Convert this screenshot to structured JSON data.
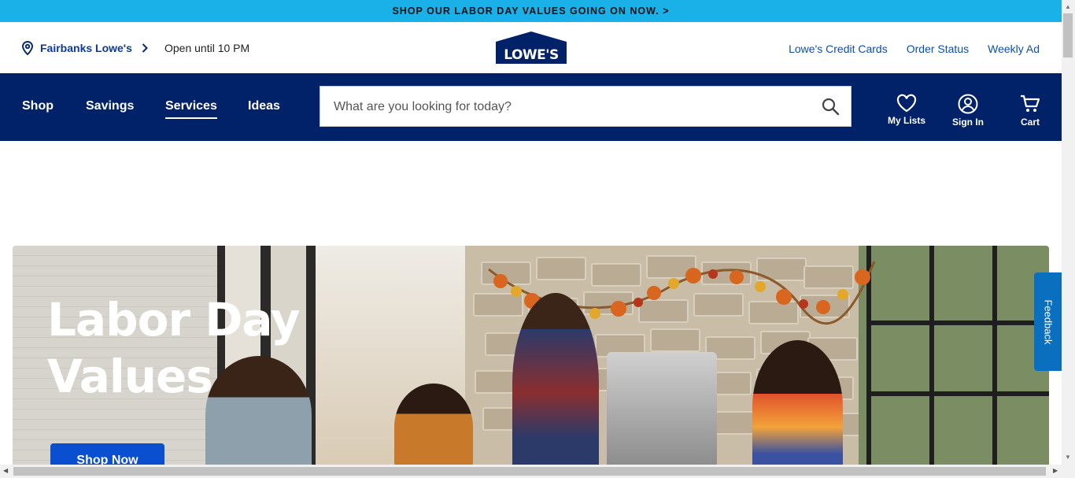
{
  "promo_banner": {
    "text": "SHOP OUR LABOR DAY VALUES GOING ON NOW. >"
  },
  "utility_bar": {
    "store_name": "Fairbanks Lowe's",
    "store_hours": "Open until 10 PM",
    "logo_text": "LOWE'S",
    "links": [
      "Lowe's Credit Cards",
      "Order Status",
      "Weekly Ad"
    ]
  },
  "main_nav": {
    "items": [
      "Shop",
      "Savings",
      "Services",
      "Ideas"
    ],
    "active_item": "Services",
    "search": {
      "placeholder": "What are you looking for today?",
      "value": ""
    },
    "icons": [
      {
        "label": "My Lists",
        "icon": "heart-icon"
      },
      {
        "label": "Sign In",
        "icon": "user-circle-icon"
      },
      {
        "label": "Cart",
        "icon": "cart-icon"
      }
    ]
  },
  "hero": {
    "title_line1": "Labor Day",
    "title_line2": "Values",
    "cta_label": "Shop Now"
  },
  "feedback_tab": {
    "label": "Feedback"
  },
  "colors": {
    "promo": "#1ab0e8",
    "nav": "#012169",
    "link": "#0b4fb0",
    "cta": "#0b4fd1",
    "feedback": "#0b6fc0"
  }
}
